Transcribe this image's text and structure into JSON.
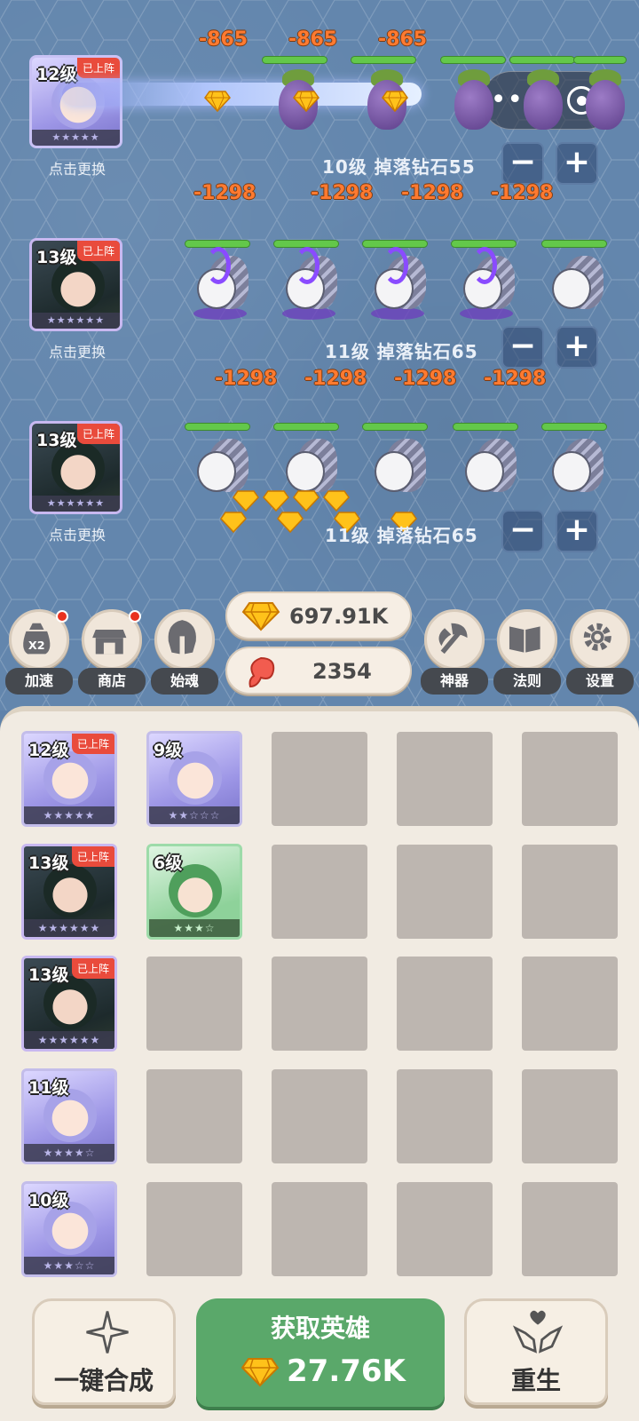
{
  "lanes": [
    {
      "hero_level": "12级",
      "hero_tag": "已上阵",
      "hero_stars": "★★★★★",
      "swap_text": "点击更换",
      "info": "10级  掉落钻石55",
      "minus": "−",
      "plus": "+",
      "damage": [
        "-865",
        "-865",
        "-865"
      ]
    },
    {
      "hero_level": "13级",
      "hero_tag": "已上阵",
      "hero_stars": "★★★★★★",
      "swap_text": "点击更换",
      "info": "11级  掉落钻石65",
      "minus": "−",
      "plus": "+",
      "damage": [
        "-1298",
        "-1298",
        "-1298",
        "-1298"
      ]
    },
    {
      "hero_level": "13级",
      "hero_tag": "已上阵",
      "hero_stars": "★★★★★★",
      "swap_text": "点击更换",
      "info": "11级  掉落钻石65",
      "minus": "−",
      "plus": "+",
      "damage": [
        "-1298",
        "-1298",
        "-1298",
        "-1298"
      ]
    }
  ],
  "capsule": {
    "more": "•••"
  },
  "resources": {
    "diamonds": "697.91K",
    "meat": "2354"
  },
  "left_buttons": [
    {
      "label": "加速",
      "icon": "speed-bag-icon",
      "icon_text": "X2"
    },
    {
      "label": "商店",
      "icon": "shop-icon"
    },
    {
      "label": "始魂",
      "icon": "helmet-icon"
    }
  ],
  "right_buttons": [
    {
      "label": "神器",
      "icon": "axe-icon"
    },
    {
      "label": "法则",
      "icon": "book-icon"
    },
    {
      "label": "设置",
      "icon": "gear-icon"
    }
  ],
  "inventory": [
    {
      "level": "12级",
      "tag": "已上阵",
      "stars": "★★★★★"
    },
    {
      "level": "9级",
      "tag": "",
      "stars": "★★☆☆☆"
    },
    {
      "level": "13级",
      "tag": "已上阵",
      "stars": "★★★★★★"
    },
    {
      "level": "6级",
      "tag": "",
      "stars": "★★★☆"
    },
    {
      "level": "13级",
      "tag": "已上阵",
      "stars": "★★★★★★"
    },
    {
      "level": "11级",
      "tag": "",
      "stars": "★★★★☆"
    },
    {
      "level": "10级",
      "tag": "",
      "stars": "★★★☆☆"
    }
  ],
  "bottom": {
    "merge_label": "一键合成",
    "get_hero_title": "获取英雄",
    "get_hero_cost": "27.76K",
    "rebirth_label": "重生"
  }
}
